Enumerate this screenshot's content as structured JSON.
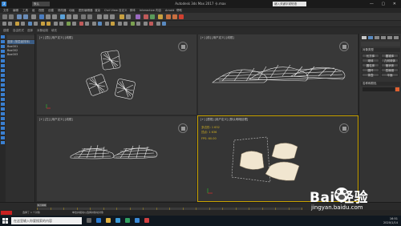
{
  "window": {
    "title": "Autodesk 3ds Max 2017    卡.max",
    "app_logo": "3",
    "workspace": "默认",
    "search_placeholder": "键入关键字或短语"
  },
  "menubar": [
    "文件",
    "编辑",
    "工具",
    "组",
    "视图",
    "创建",
    "修改器",
    "动画",
    "图形编辑器",
    "渲染",
    "Civil View",
    "自定义",
    "脚本",
    "Interactive",
    "内容",
    "Arnold",
    "帮助"
  ],
  "ribbon": [
    "建模",
    "自由形式",
    "选择",
    "对象绘制",
    "填充"
  ],
  "explorer": {
    "items": [
      "选择 (按层级排序)",
      "Box001",
      "Box002",
      "Box003"
    ]
  },
  "viewports": {
    "top": {
      "label": "[+] [顶] [用户定义] [线框]"
    },
    "front": {
      "label": "[+] [前] [用户定义] [线框]"
    },
    "left": {
      "label": "[+] [左] [用户定义] [线框]"
    },
    "persp": {
      "label": "[+] [透视] [用户定义] [默认明暗处理]"
    }
  },
  "persp_info": {
    "lines": [
      {
        "label": "多边形:",
        "value": "1 632"
      },
      {
        "label": "顶点:",
        "value": "1 636"
      },
      {
        "label": "FPS:",
        "value": "60.00"
      }
    ]
  },
  "command_panel": {
    "sections": [
      "对象类型",
      "名称和颜色"
    ],
    "buttons": [
      "长方体",
      "圆锥体",
      "球体",
      "几何球体",
      "圆柱体",
      "管状体",
      "圆环",
      "四棱锥",
      "茶壶",
      "平面"
    ]
  },
  "timeline": {
    "frame_label": "0 / 100",
    "ticks": [
      0,
      5,
      10,
      15,
      20,
      25,
      30,
      35,
      40,
      45,
      50,
      55,
      60,
      65,
      70,
      75,
      80,
      85,
      90,
      95,
      100
    ]
  },
  "status": {
    "left": "选择了 1 个对象",
    "hint": "单击并拖动以选择并移动对象"
  },
  "taskbar": {
    "search_placeholder": "在这里输入你要搜索的内容",
    "time": "16:51",
    "date": "2020/1/14"
  },
  "watermark": {
    "brand": "Bai 经验",
    "url": "jingyan.baidu.com"
  },
  "colors": {
    "accent": "#c9a200",
    "wire": "#e8e8e8",
    "pillow": "#f1e6d0",
    "selection": "#3b5d85"
  }
}
